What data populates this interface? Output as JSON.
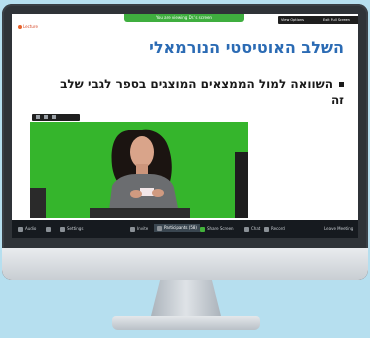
{
  "share_banner": "You are viewing Dr.'s screen",
  "top_buttons": {
    "view_options": "View Options",
    "exit_fullscreen": "Exit Full Screen"
  },
  "logo": {
    "text": "Lecture"
  },
  "slide": {
    "title": "השלב האוטיסטי הנורמאלי",
    "bullet": "השוואה למול הממצאים המוצגים בספר לגבי שלב זה"
  },
  "taskbar": {
    "audio": "Audio",
    "video": "",
    "settings": "Settings",
    "invite": "Invite",
    "participants": "Participants (58)",
    "share_screen": "Share Screen",
    "chat": "Chat",
    "record": "Record",
    "leave": "Leave Meeting"
  },
  "colors": {
    "title": "#2b6bb4",
    "green_screen": "#35b52c",
    "taskbar": "#161a1f",
    "background": "#b6dfef"
  }
}
